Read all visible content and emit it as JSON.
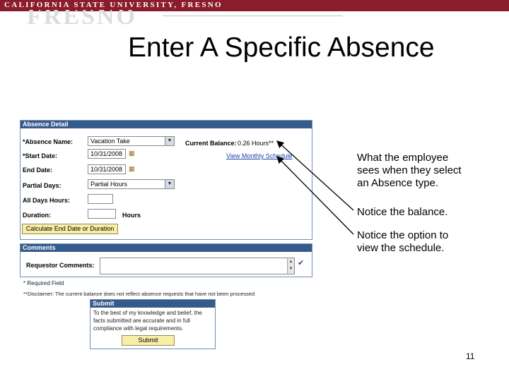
{
  "banner": {
    "university": "CALIFORNIA STATE UNIVERSITY, FRESNO",
    "watermark": "FRESNO"
  },
  "slide": {
    "title": "Enter A Specific Absence",
    "page_number": "11"
  },
  "absence_detail": {
    "header": "Absence Detail",
    "absence_name_label": "*Absence Name:",
    "absence_name_value": "Vacation Take",
    "current_balance_label": "Current Balance:",
    "current_balance_value": "0.26 Hours**",
    "start_date_label": "*Start Date:",
    "start_date_value": "10/31/2008",
    "view_schedule_link": "View Monthly Schedule",
    "end_date_label": "End Date:",
    "end_date_value": "10/31/2008",
    "partial_days_label": "Partial Days:",
    "partial_days_value": "Partial Hours",
    "all_days_hours_label": "All Days Hours:",
    "all_days_hours_value": "",
    "duration_label": "Duration:",
    "duration_value": "",
    "duration_unit": "Hours",
    "calculate_button": "Calculate End Date or Duration"
  },
  "comments": {
    "header": "Comments",
    "requestor_label": "Requestor Comments:",
    "requestor_value": ""
  },
  "notes": {
    "required": "* Required Field",
    "disclaimer": "**Disclaimer: The current balance does not reflect absence requests that have not been processed"
  },
  "submit_panel": {
    "header": "Submit",
    "line1": "To the best of my knowledge and belief, the",
    "line2": "facts submitted are accurate and in full",
    "line3": "compliance with legal requirements.",
    "submit_button": "Submit"
  },
  "callouts": {
    "c1_line1": "What the employee",
    "c1_line2": "sees when they select",
    "c1_line3": "an Absence type.",
    "c2": "Notice the balance.",
    "c3_line1": "Notice the option to",
    "c3_line2": "view the schedule."
  },
  "colors": {
    "banner": "#8b1c2c",
    "panel_header": "#355b8c",
    "button": "#f7eea8",
    "link": "#1f3fa8"
  }
}
